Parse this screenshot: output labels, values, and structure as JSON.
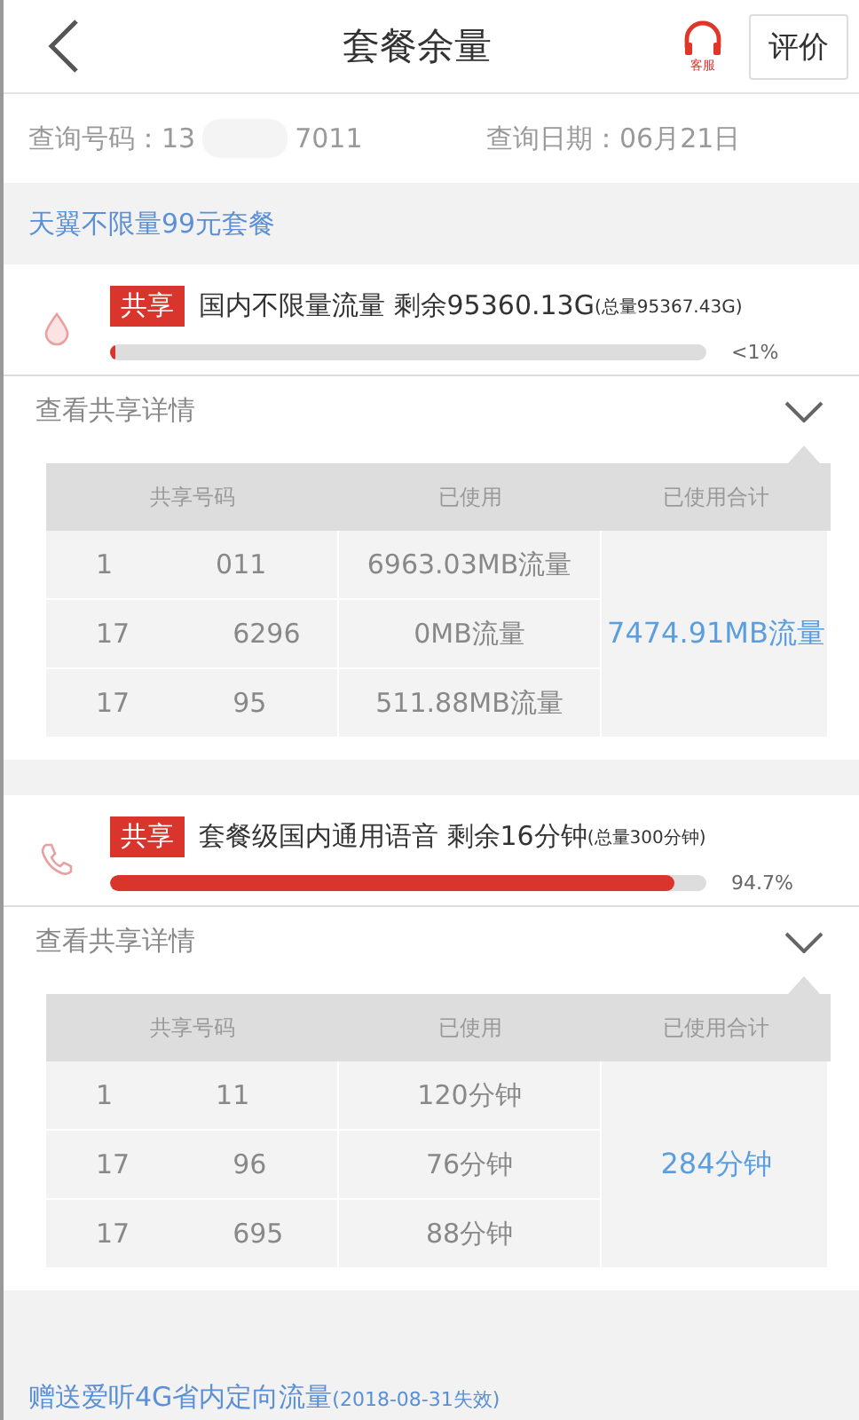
{
  "header": {
    "title": "套餐余量",
    "service_label": "客服",
    "review_button": "评价"
  },
  "query": {
    "number_label": "查询号码：",
    "number_prefix": "13",
    "number_suffix": "7011",
    "date_label": "查询日期：",
    "date": "06月21日"
  },
  "plan_title": "天翼不限量99元套餐",
  "items": [
    {
      "kind": "data",
      "tag": "共享",
      "name": "国内不限量流量 剩余95360.13G",
      "total": "(总量95367.43G)",
      "level": 0.01,
      "percent": "<1%",
      "details_label": "查看共享详情",
      "expanded": true,
      "table": {
        "columns": [
          "共享号码",
          "已使用",
          "已使用合计"
        ],
        "total": "7474.91MB流量",
        "rows": [
          {
            "number_prefix": "1",
            "number_suffix": "011",
            "used": "6963.03MB流量"
          },
          {
            "number_prefix": "17",
            "number_suffix": "6296",
            "used": "0MB流量"
          },
          {
            "number_prefix": "17",
            "number_suffix": "95",
            "used": "511.88MB流量"
          }
        ]
      }
    },
    {
      "kind": "voice",
      "tag": "共享",
      "name": "套餐级国内通用语音 剩余16分钟",
      "total": "(总量300分钟)",
      "level": 0.947,
      "percent": "94.7%",
      "details_label": "查看共享详情",
      "expanded": true,
      "table": {
        "columns": [
          "共享号码",
          "已使用",
          "已使用合计"
        ],
        "total": "284分钟",
        "rows": [
          {
            "number_prefix": "1",
            "number_suffix": "11",
            "used": "120分钟"
          },
          {
            "number_prefix": "17",
            "number_suffix": "96",
            "used": "76分钟"
          },
          {
            "number_prefix": "17",
            "number_suffix": "695",
            "used": "88分钟"
          }
        ]
      }
    }
  ],
  "footer": {
    "name": "赠送爱听4G省内定向流量",
    "note": "(2018-08-31失效)"
  }
}
